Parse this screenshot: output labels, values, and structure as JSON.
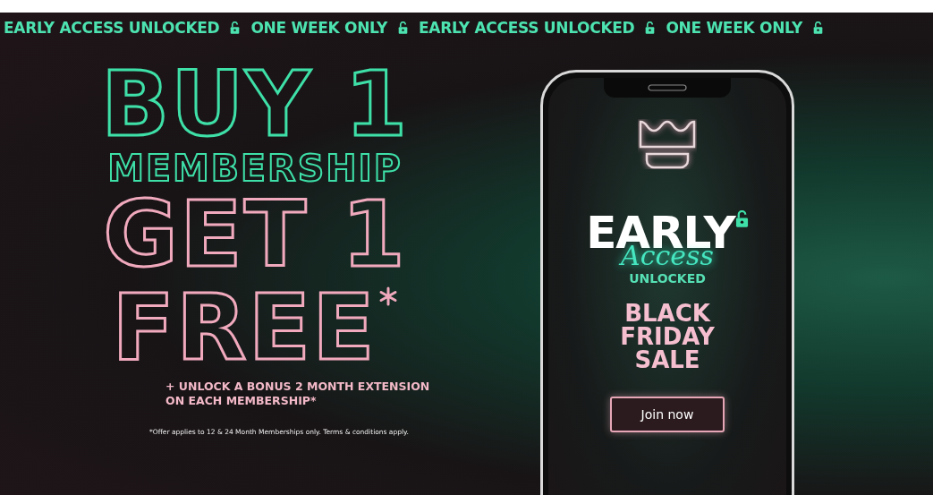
{
  "ticker": [
    "EARLY ACCESS UNLOCKED",
    "ONE WEEK ONLY",
    "EARLY ACCESS UNLOCKED",
    "ONE WEEK ONLY"
  ],
  "headline": {
    "line_1": "BUY 1",
    "line_2": "MEMBERSHIP",
    "line_3": "GET 1",
    "line_4": "FREE"
  },
  "offer": [
    "+ UNLOCK A BONUS 2 MONTH EXTENSION",
    "ON EACH MEMBERSHIP*"
  ],
  "fine_print": "*Offer applies to 12 & 24 Month Memberships only. Terms & conditions apply.",
  "phone": {
    "title": "EARLY",
    "script": "Access",
    "subtitle": "UNLOCKED",
    "sale": [
      "BLACK",
      "FRIDAY",
      "SALE"
    ],
    "button": "Join now"
  }
}
